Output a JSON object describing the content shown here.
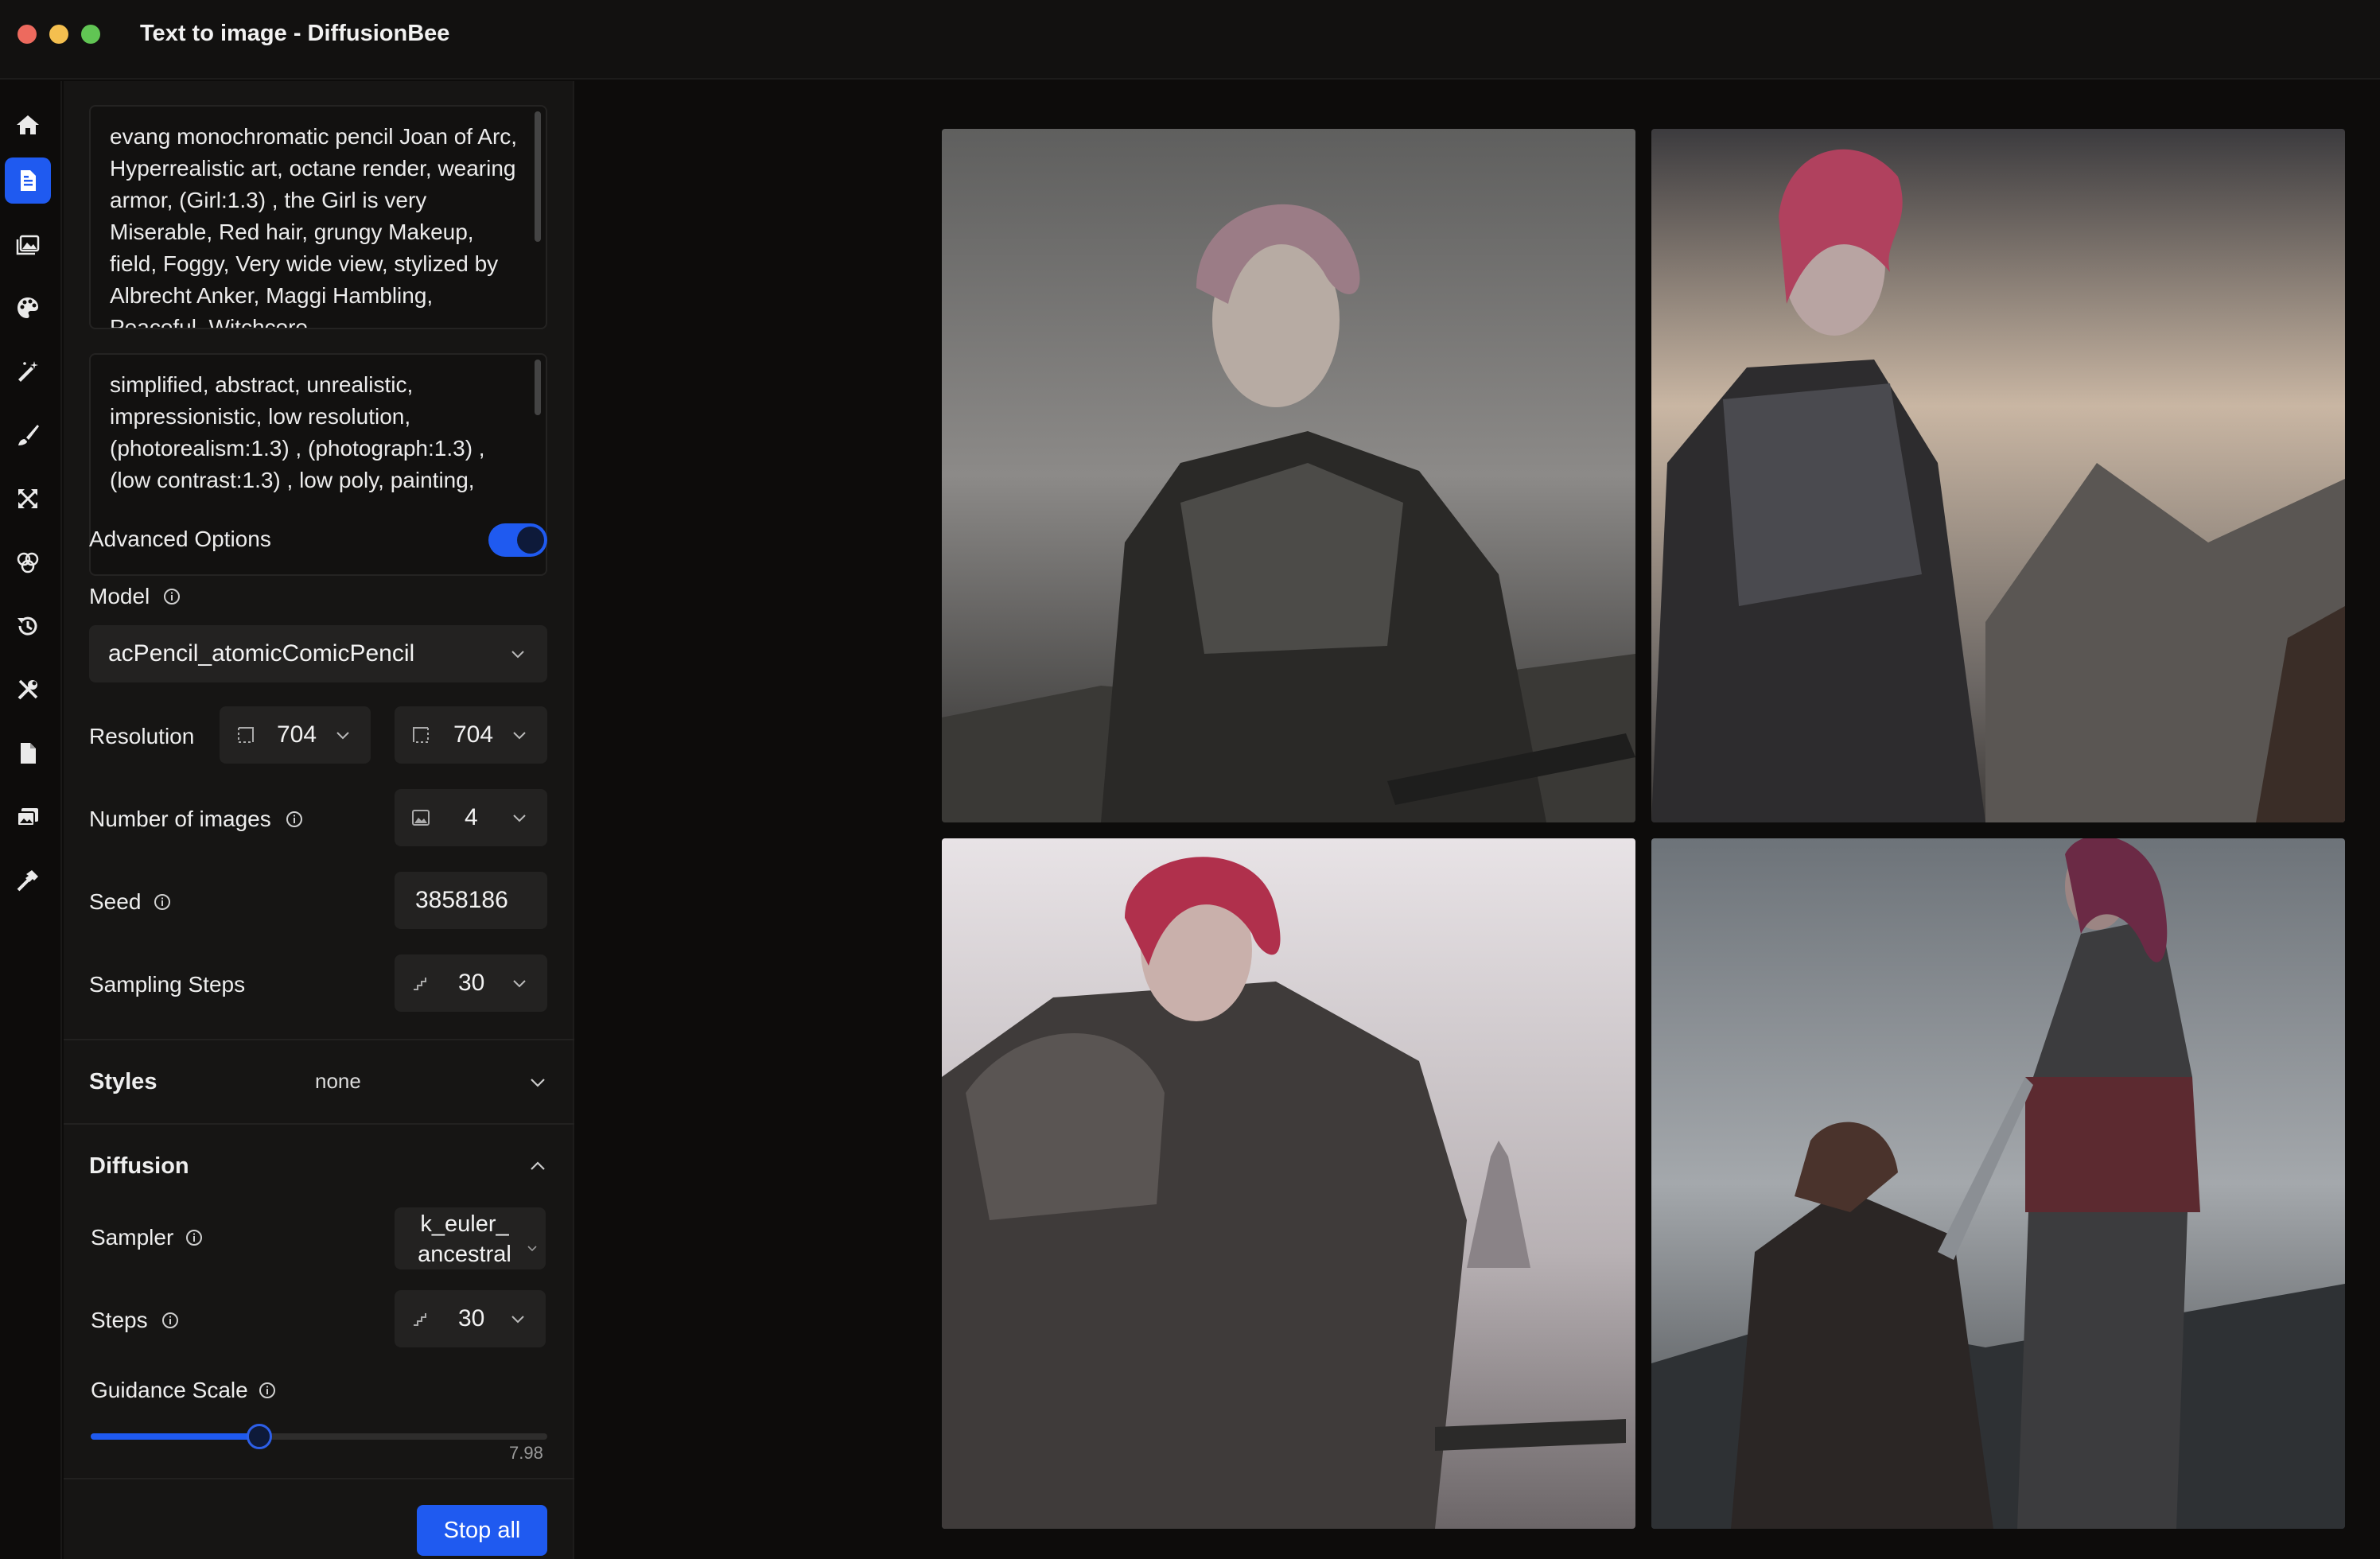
{
  "window": {
    "title": "Text to image - DiffusionBee"
  },
  "rail": {
    "items": [
      {
        "name": "home-icon",
        "active": false
      },
      {
        "name": "text-to-image-icon",
        "active": true
      },
      {
        "name": "image-to-image-icon",
        "active": false
      },
      {
        "name": "palette-icon",
        "active": false
      },
      {
        "name": "magic-wand-icon",
        "active": false
      },
      {
        "name": "brush-icon",
        "active": false
      },
      {
        "name": "upscale-icon",
        "active": false
      },
      {
        "name": "mix-icon",
        "active": false
      },
      {
        "name": "history-icon",
        "active": false
      },
      {
        "name": "tools-icon",
        "active": false
      },
      {
        "name": "document-icon",
        "active": false
      },
      {
        "name": "gallery-icon",
        "active": false
      },
      {
        "name": "hammer-icon",
        "active": false
      }
    ]
  },
  "panel": {
    "prompt": "evang monochromatic pencil Joan of Arc, Hyperrealistic art, octane render, wearing armor, (Girl:1.3) , the Girl is very Miserable, Red hair, grungy Makeup, field, Foggy, Very wide view, stylized by Albrecht Anker, Maggi Hambling, Peaceful, Witchcore",
    "negative_prompt": "simplified, abstract, unrealistic, impressionistic, low resolution, (photorealism:1.3) , (photograph:1.3) , (low contrast:1.3) , low poly, painting,",
    "advanced_options_label": "Advanced Options",
    "advanced_options_on": true,
    "model_label": "Model",
    "model_value": "acPencil_atomicComicPencil",
    "resolution_label": "Resolution",
    "width_value": "704",
    "height_value": "704",
    "num_images_label": "Number of images",
    "num_images_value": "4",
    "seed_label": "Seed",
    "seed_value": "3858186",
    "sampling_steps_label": "Sampling Steps",
    "sampling_steps_value": "30",
    "styles_label": "Styles",
    "styles_value": "none",
    "diffusion_label": "Diffusion",
    "sampler_label": "Sampler",
    "sampler_value_line1": "k_euler_",
    "sampler_value_line2": "ancestral",
    "steps_label": "Steps",
    "steps_value": "30",
    "guidance_label": "Guidance Scale",
    "guidance_value": "7.98",
    "guidance_fraction": 0.37,
    "stop_label": "Stop all"
  },
  "colors": {
    "accent": "#1f5af0",
    "panel": "#161514",
    "background": "#0d0c0b"
  }
}
